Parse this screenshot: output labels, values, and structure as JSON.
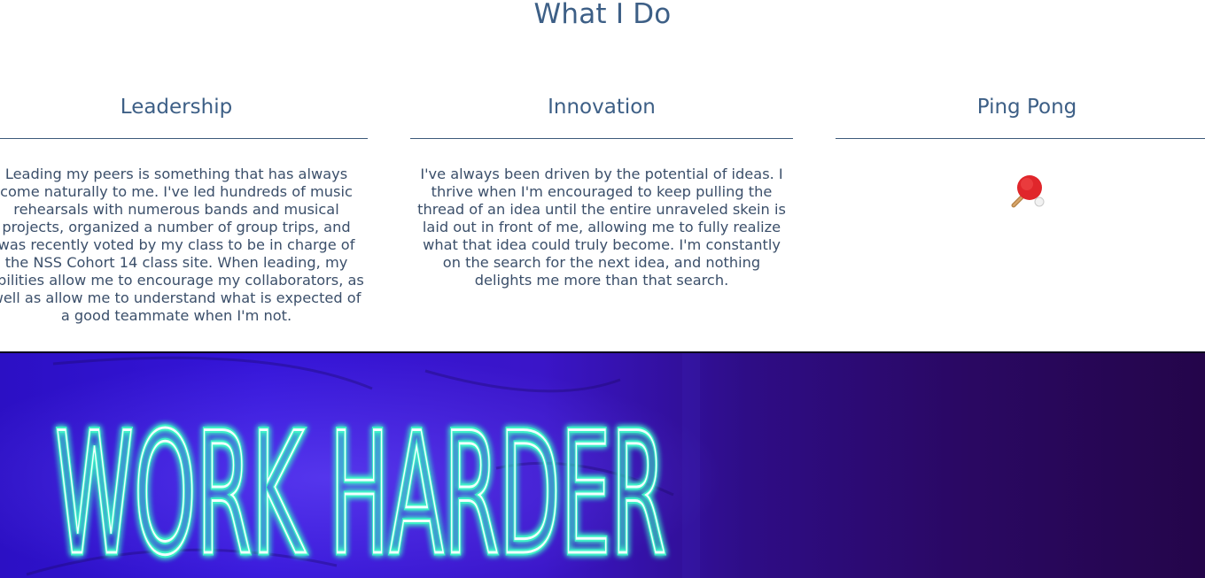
{
  "section": {
    "title": "What I Do"
  },
  "columns": [
    {
      "heading": "Leadership",
      "body": "Leading my peers is something that has always come naturally to me. I've led hundreds of music rehearsals with numerous bands and musical projects, organized a number of group trips, and was recently voted by my class to be in charge of the NSS Cohort 14 class site. When leading, my abilities allow me to encourage my collaborators, as well as allow me to understand what is expected of a good teammate when I'm not."
    },
    {
      "heading": "Innovation",
      "body": "I've always been driven by the potential of ideas. I thrive when I'm encouraged to keep pulling the thread of an idea until the entire unraveled skein is laid out in front of me, allowing me to fully realize what that idea could truly become. I'm constantly on the search for the next idea, and nothing delights me more than that search."
    },
    {
      "heading": "Ping Pong",
      "icon": "ping-pong-paddle-icon"
    }
  ],
  "hero": {
    "sign_text": "WORK HARDER",
    "colors": {
      "background": "#3515d9",
      "neon": "#e8ffff",
      "neon_glow": "#3cf0c8"
    }
  }
}
